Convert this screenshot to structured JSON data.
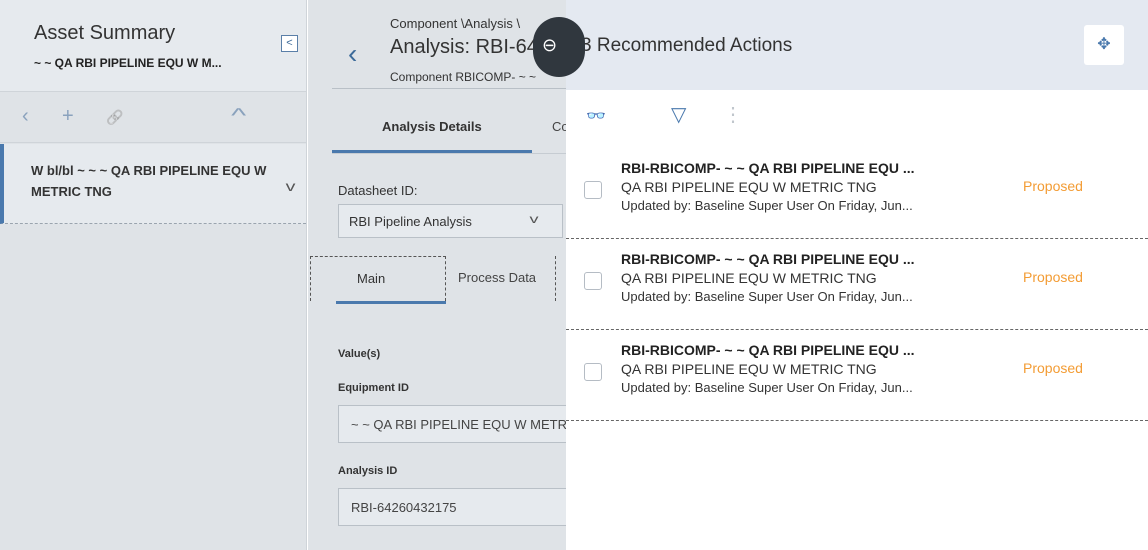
{
  "asset_summary": {
    "title": "Asset Summary",
    "subtitle": "~ ~ QA RBI PIPELINE EQU W M...",
    "collapse_icon": "collapse-left-icon",
    "toolbar": {
      "back": "‹",
      "add": "+",
      "link": "🔗",
      "collapse": "^"
    },
    "tree_item": "W bl/bl ~ ~ ~ QA RBI PIPELINE EQU W METRIC TNG"
  },
  "analysis": {
    "breadcrumb": "Component \\Analysis \\",
    "title": "Analysis: RBI-64",
    "component": "Component RBICOMP- ~ ~",
    "tabs": {
      "details": "Analysis Details",
      "next": "Co"
    },
    "datasheet_label": "Datasheet ID:",
    "datasheet_value": "RBI Pipeline Analysis",
    "subtabs": {
      "main": "Main",
      "process": "Process Data"
    },
    "values_label": "Value(s)",
    "equipment_label": "Equipment ID",
    "equipment_value": "~ ~ QA RBI PIPELINE EQU W METRIC",
    "analysis_label": "Analysis ID",
    "analysis_value": "RBI-64260432175"
  },
  "recommended": {
    "title": "3 Recommended Actions",
    "toggle_icon": "slide-toggle-icon",
    "expand_icon": "move-arrows-icon",
    "toolbar": {
      "find": "👓",
      "filter": "▽",
      "more": "⋮"
    },
    "status_color": "#f39c34",
    "items": [
      {
        "title": "RBI-RBICOMP- ~ ~ QA RBI PIPELINE EQU ...",
        "equipment": "QA RBI PIPELINE EQU W METRIC TNG",
        "updated": "Updated by: Baseline Super User On  Friday, Jun...",
        "status": "Proposed"
      },
      {
        "title": "RBI-RBICOMP- ~ ~ QA RBI PIPELINE EQU ...",
        "equipment": "QA RBI PIPELINE EQU W METRIC TNG",
        "updated": "Updated by: Baseline Super User On  Friday, Jun...",
        "status": "Proposed"
      },
      {
        "title": "RBI-RBICOMP- ~ ~ QA RBI PIPELINE EQU ...",
        "equipment": "QA RBI PIPELINE EQU W METRIC TNG",
        "updated": "Updated by: Baseline Super User On  Friday, Jun...",
        "status": "Proposed"
      }
    ]
  }
}
